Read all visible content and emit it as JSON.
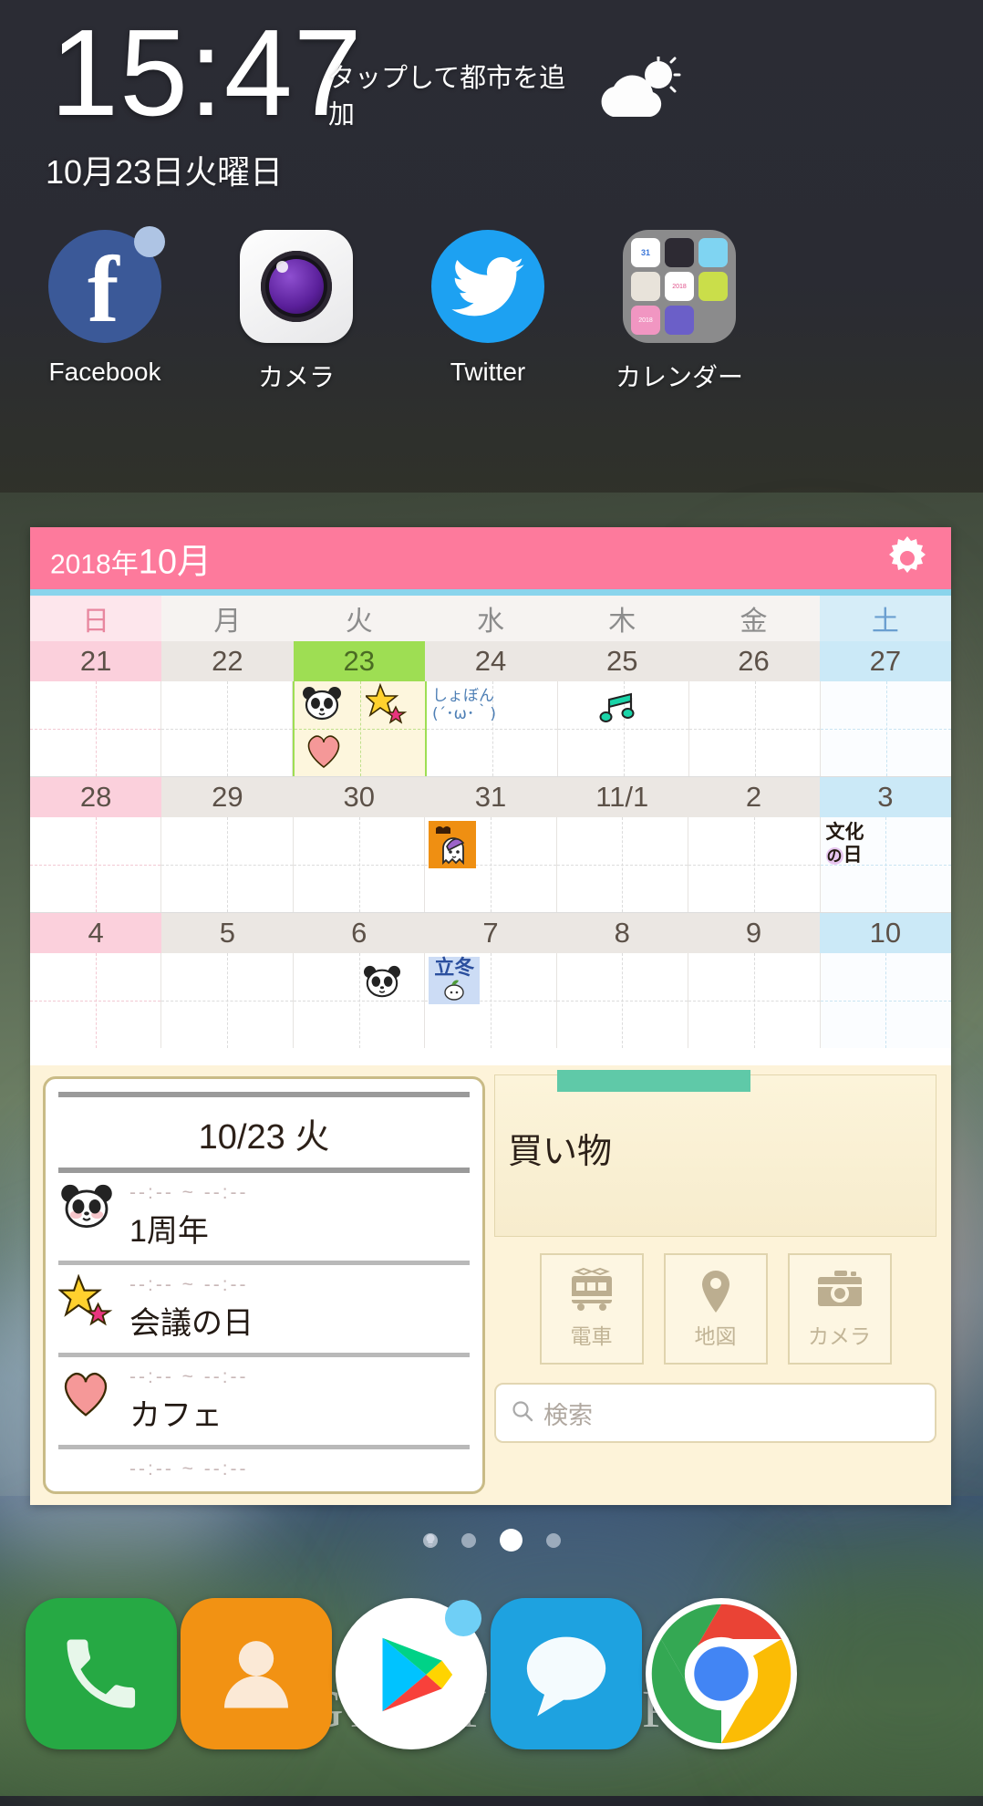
{
  "statusbar": {},
  "clock_widget": {
    "time": "15:47",
    "weather_prompt": "タップして都市を追加",
    "weather_icon": "partly-cloudy-icon",
    "date": "10月23日火曜日"
  },
  "app_row": [
    {
      "label": "Facebook",
      "icon": "facebook-icon",
      "badge": true
    },
    {
      "label": "カメラ",
      "icon": "camera-icon",
      "badge": false
    },
    {
      "label": "Twitter",
      "icon": "twitter-icon",
      "badge": false
    },
    {
      "label": "カレンダー",
      "icon": "calendar-folder-icon",
      "badge": false
    }
  ],
  "calendar_widget": {
    "header": {
      "year": "2018年",
      "month": "10月",
      "settings_icon": "gear-icon"
    },
    "weekdays": [
      "日",
      "月",
      "火",
      "水",
      "木",
      "金",
      "土"
    ],
    "weeks": [
      {
        "days": [
          {
            "num": "21",
            "kind": "sun",
            "stickers": []
          },
          {
            "num": "22",
            "kind": "weekday",
            "stickers": []
          },
          {
            "num": "23",
            "kind": "today",
            "stickers": [
              "panda-sticker",
              "star-sticker",
              "heart-sticker"
            ]
          },
          {
            "num": "24",
            "kind": "weekday",
            "stickers": [
              "shobon-emoticon"
            ],
            "text": "しょぼん\n(´･ω･｀)"
          },
          {
            "num": "25",
            "kind": "weekday",
            "stickers": [
              "music-note-sticker"
            ]
          },
          {
            "num": "26",
            "kind": "weekday",
            "stickers": []
          },
          {
            "num": "27",
            "kind": "sat",
            "stickers": []
          }
        ]
      },
      {
        "days": [
          {
            "num": "28",
            "kind": "sun",
            "stickers": []
          },
          {
            "num": "29",
            "kind": "weekday",
            "stickers": []
          },
          {
            "num": "30",
            "kind": "weekday",
            "stickers": []
          },
          {
            "num": "31",
            "kind": "weekday",
            "stickers": [
              "halloween-ghost-sticker"
            ]
          },
          {
            "num": "11/1",
            "kind": "weekday",
            "stickers": []
          },
          {
            "num": "2",
            "kind": "weekday",
            "stickers": []
          },
          {
            "num": "3",
            "kind": "sat",
            "stickers": [
              "bunka-no-hi-sticker"
            ],
            "text": "文化の日"
          }
        ]
      },
      {
        "days": [
          {
            "num": "4",
            "kind": "sun",
            "stickers": []
          },
          {
            "num": "5",
            "kind": "weekday",
            "stickers": []
          },
          {
            "num": "6",
            "kind": "weekday",
            "stickers": [
              "panda-sticker"
            ]
          },
          {
            "num": "7",
            "kind": "weekday",
            "stickers": [
              "rittou-sticker"
            ],
            "text": "立冬"
          },
          {
            "num": "8",
            "kind": "weekday",
            "stickers": []
          },
          {
            "num": "9",
            "kind": "weekday",
            "stickers": []
          },
          {
            "num": "10",
            "kind": "sat",
            "stickers": []
          }
        ]
      }
    ]
  },
  "agenda": {
    "title": "10/23 火",
    "entries": [
      {
        "icon": "panda-sticker",
        "time": "--:-- ~ --:--",
        "name": "1周年"
      },
      {
        "icon": "star-sticker",
        "time": "--:-- ~ --:--",
        "name": "会議の日"
      },
      {
        "icon": "heart-sticker",
        "time": "--:-- ~ --:--",
        "name": "カフェ"
      },
      {
        "icon": "none",
        "time": "--:-- ~ --:--",
        "name": ""
      }
    ]
  },
  "memo": {
    "title": "買い物",
    "tape_color": "#5fc9a8"
  },
  "shortcuts": [
    {
      "label": "電車",
      "icon": "train-icon"
    },
    {
      "label": "地図",
      "icon": "map-pin-icon"
    },
    {
      "label": "カメラ",
      "icon": "camera-icon"
    }
  ],
  "search": {
    "placeholder": "検索",
    "icon": "search-icon"
  },
  "page_indicator": {
    "count": 4,
    "active_index": 2,
    "first_is_assistant": true
  },
  "dock": [
    {
      "name": "phone",
      "icon": "phone-icon",
      "color": "#26a944"
    },
    {
      "name": "contacts",
      "icon": "contacts-icon",
      "color": "#f29213"
    },
    {
      "name": "play-store",
      "icon": "play-store-icon",
      "color": "#ffffff",
      "badge": true
    },
    {
      "name": "messages",
      "icon": "message-icon",
      "color": "#1ea2e0"
    },
    {
      "name": "chrome",
      "icon": "chrome-icon",
      "color": "#ffffff"
    }
  ],
  "wallpaper": {
    "watermark": "GIRLY DROP"
  },
  "colors": {
    "calendar_header": "#fd7a9c",
    "today_highlight": "#9ede53",
    "sunday": "#fbd0dc",
    "saturday": "#cbe9f7",
    "panel_bg": "#fdf3d9"
  }
}
